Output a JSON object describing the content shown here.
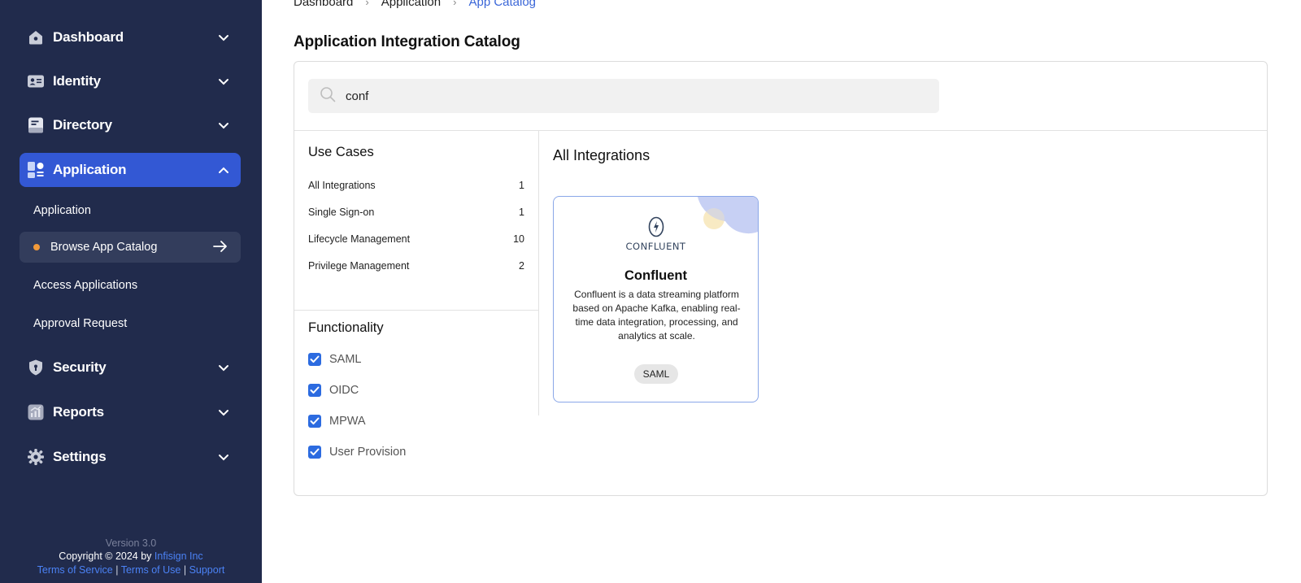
{
  "sidebar": {
    "nav": [
      {
        "label": "Dashboard",
        "icon": "home-icon"
      },
      {
        "label": "Identity",
        "icon": "id-card-icon"
      },
      {
        "label": "Directory",
        "icon": "directory-icon"
      },
      {
        "label": "Application",
        "icon": "apps-grid-icon"
      },
      {
        "label": "Security",
        "icon": "shield-icon"
      },
      {
        "label": "Reports",
        "icon": "reports-chart-icon"
      },
      {
        "label": "Settings",
        "icon": "gear-icon"
      }
    ],
    "application_sub": [
      {
        "label": "Application"
      },
      {
        "label": "Browse App Catalog"
      },
      {
        "label": "Access Applications"
      },
      {
        "label": "Approval Request"
      }
    ],
    "footer": {
      "version": "Version 3.0",
      "copyright": "Copyright © 2024 by",
      "company": "Infisign Inc",
      "terms_service": "Terms of Service",
      "terms_use": "Terms of Use",
      "support": "Support",
      "separator": " | "
    },
    "active_color": "#3358d4",
    "bg_color": "#212b4c"
  },
  "breadcrumb": {
    "items": [
      "Dashboard",
      "Application",
      "App Catalog"
    ],
    "separator": "›"
  },
  "page_title": "Application Integration Catalog",
  "search": {
    "value": "conf",
    "placeholder": ""
  },
  "use_cases": {
    "title": "Use Cases",
    "items": [
      {
        "label": "All Integrations",
        "count": "1"
      },
      {
        "label": "Single Sign-on",
        "count": "1"
      },
      {
        "label": "Lifecycle Management",
        "count": "10"
      },
      {
        "label": "Privilege Management",
        "count": "2"
      }
    ]
  },
  "functionality": {
    "title": "Functionality",
    "items": [
      {
        "label": "SAML",
        "checked": true
      },
      {
        "label": "OIDC",
        "checked": true
      },
      {
        "label": "MPWA",
        "checked": true
      },
      {
        "label": "User Provision",
        "checked": true
      }
    ]
  },
  "integrations": {
    "title": "All Integrations",
    "cards": [
      {
        "logo_text": "CONFLUENT",
        "name": "Confluent",
        "description": "Confluent is a data streaming platform based on Apache Kafka, enabling real-time data integration, processing, and analytics at scale.",
        "tag": "SAML"
      }
    ]
  }
}
